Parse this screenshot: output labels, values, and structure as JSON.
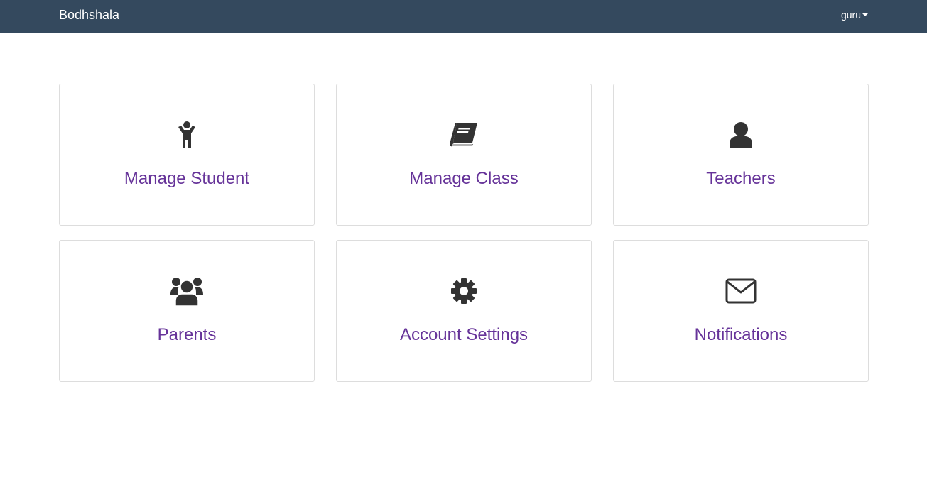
{
  "navbar": {
    "brand": "Bodhshala",
    "user": "guru"
  },
  "tiles": [
    {
      "label": "Manage Student",
      "icon": "child-icon"
    },
    {
      "label": "Manage Class",
      "icon": "book-icon"
    },
    {
      "label": "Teachers",
      "icon": "user-icon"
    },
    {
      "label": "Parents",
      "icon": "users-icon"
    },
    {
      "label": "Account Settings",
      "icon": "gear-icon"
    },
    {
      "label": "Notifications",
      "icon": "envelope-icon"
    }
  ],
  "colors": {
    "navbar": "#34495e",
    "link": "#663399",
    "icon": "#333333"
  }
}
